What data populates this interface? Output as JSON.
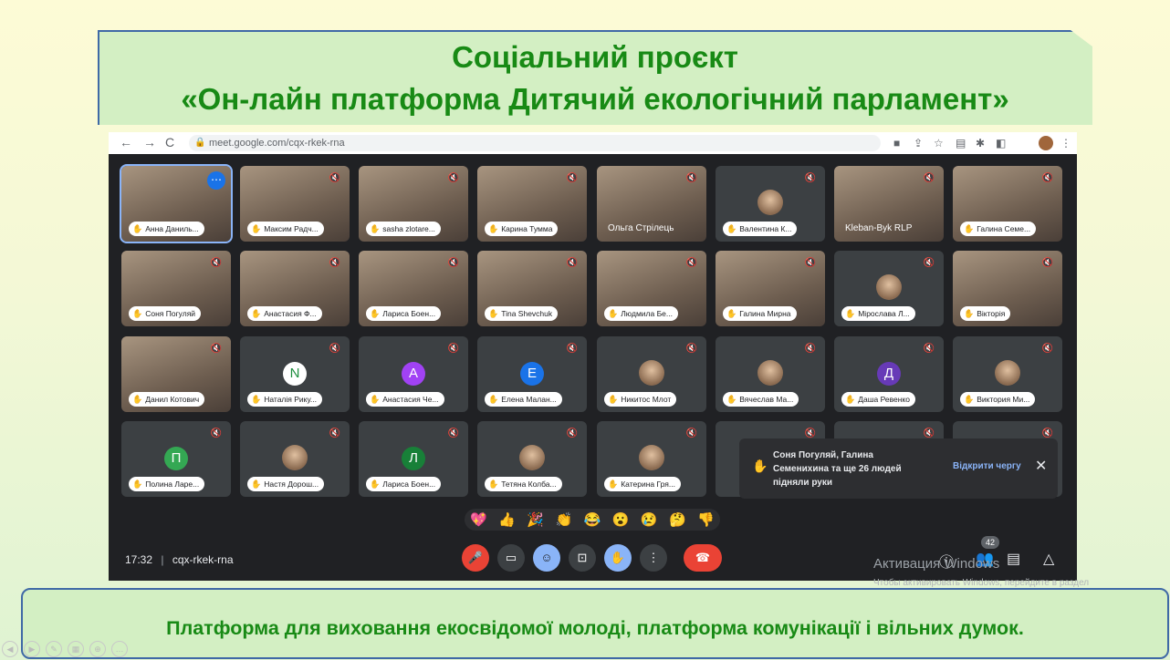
{
  "slide": {
    "title_line1": "Соціальний проєкт",
    "title_line2": "«Он-лайн платформа Дитячий екологічний парламент»",
    "footer": "Платформа для виховання екосвідомої молоді, платформа комунікації і вільних думок."
  },
  "browser": {
    "url": "meet.google.com/cqx-rkek-rna"
  },
  "participants": [
    {
      "name": "Анна Даниль...",
      "type": "video",
      "active": true
    },
    {
      "name": "Максим Радч...",
      "type": "video"
    },
    {
      "name": "sasha zlotare...",
      "type": "video"
    },
    {
      "name": "Карина Тумма",
      "type": "video"
    },
    {
      "name": "Ольга Стрілець",
      "type": "video",
      "plain": true
    },
    {
      "name": "Валентина К...",
      "type": "pic"
    },
    {
      "name": "Kleban-Byk RLP",
      "type": "video",
      "plain": true
    },
    {
      "name": "Галина Семе...",
      "type": "video"
    },
    {
      "name": "Соня Погуляй",
      "type": "video"
    },
    {
      "name": "Анастасия Ф...",
      "type": "video"
    },
    {
      "name": "Лариса Боен...",
      "type": "video"
    },
    {
      "name": "Tina Shevchuk",
      "type": "video"
    },
    {
      "name": "Людмила Бе...",
      "type": "video"
    },
    {
      "name": "Галина Мирна",
      "type": "video"
    },
    {
      "name": "Мірослава Л...",
      "type": "pic"
    },
    {
      "name": "Вікторія",
      "type": "video"
    },
    {
      "name": "Данил Котович",
      "type": "video"
    },
    {
      "name": "Наталія Рику...",
      "type": "letter",
      "letter": "N",
      "color": "#ffffff",
      "fg": "#1e8e3e"
    },
    {
      "name": "Анастасия Че...",
      "type": "letter",
      "letter": "А",
      "color": "#a142f4"
    },
    {
      "name": "Елена Малан...",
      "type": "letter",
      "letter": "Е",
      "color": "#1a73e8"
    },
    {
      "name": "Никитос Млот",
      "type": "pic"
    },
    {
      "name": "Вячеслав Ма...",
      "type": "pic"
    },
    {
      "name": "Даша Ревенко",
      "type": "letter",
      "letter": "Д",
      "color": "#673ab7"
    },
    {
      "name": "Виктория Ми...",
      "type": "pic"
    },
    {
      "name": "Полина Ларе...",
      "type": "letter",
      "letter": "П",
      "color": "#34a853"
    },
    {
      "name": "Настя Дорош...",
      "type": "pic"
    },
    {
      "name": "Лариса Боен...",
      "type": "letter",
      "letter": "Л",
      "color": "#188038"
    },
    {
      "name": "Тетяна Колба...",
      "type": "pic"
    },
    {
      "name": "Катерина Гря...",
      "type": "pic"
    },
    {
      "name": "",
      "type": "blank"
    },
    {
      "name": "",
      "type": "blank"
    },
    {
      "name": "",
      "type": "blank"
    }
  ],
  "notification": {
    "text": "Соня Погуляй, Галина Семенихина та ще 26 людей підняли руки",
    "action": "Відкрити чергу"
  },
  "reactions": [
    "💖",
    "👍",
    "🎉",
    "👏",
    "😂",
    "😮",
    "😢",
    "🤔",
    "👎"
  ],
  "meeting": {
    "time": "17:32",
    "code": "cqx-rkek-rna",
    "participant_count": "42"
  },
  "watermark": {
    "title": "Активация Windows",
    "subtitle": "Чтобы активировать Windows, перейдите в раздел \"Параметры\"."
  }
}
